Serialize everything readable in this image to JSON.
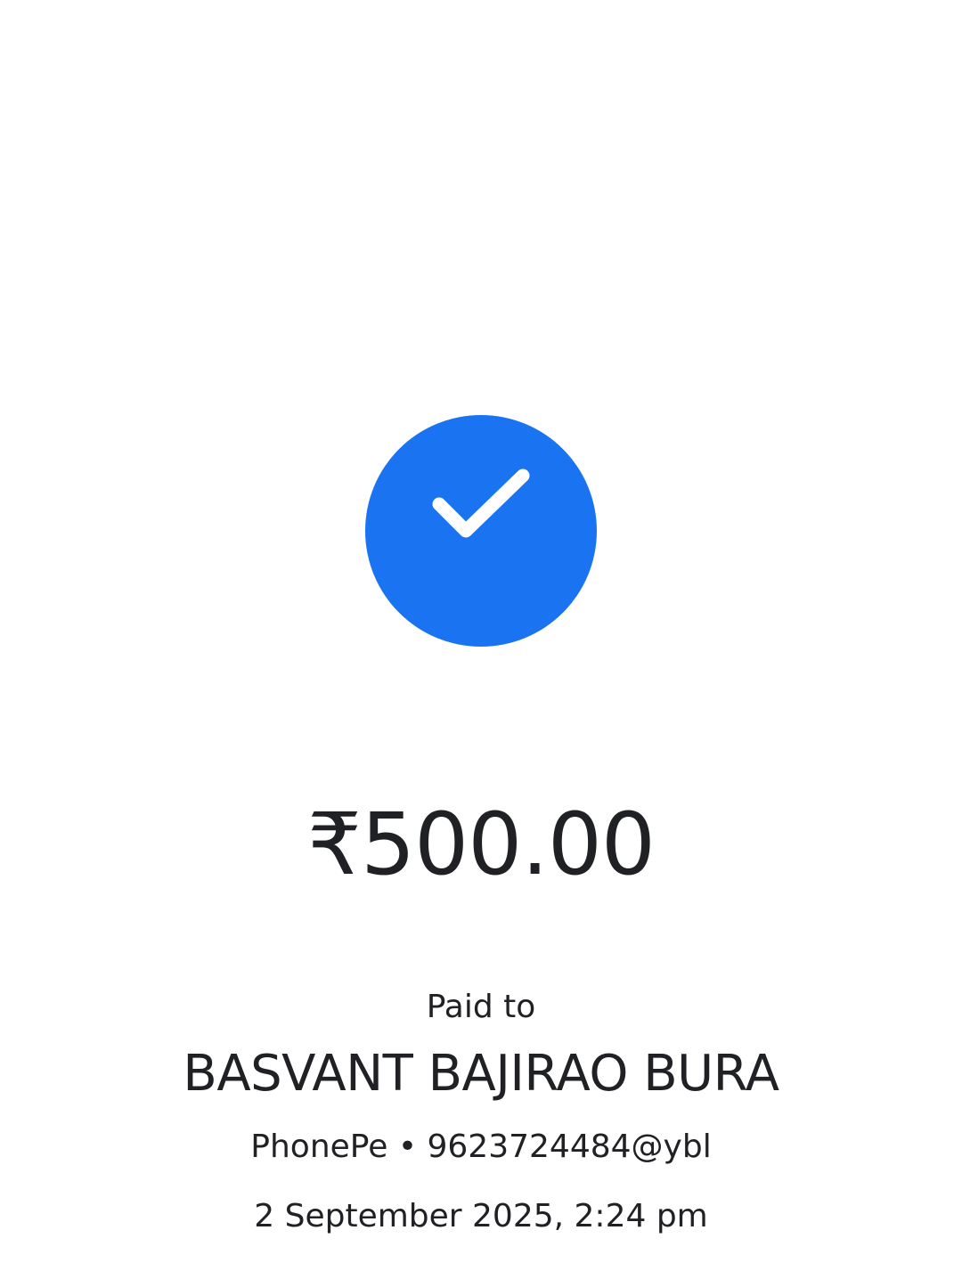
{
  "status": {
    "icon": "check-icon",
    "accent_color": "#1a73f0"
  },
  "payment": {
    "amount": "₹500.00",
    "paid_to_label": "Paid to",
    "recipient_name": "BASVANT BAJIRAO BURA",
    "recipient_upi": "PhonePe • 9623724484@ybl",
    "timestamp": "2 September 2025, 2:24 pm"
  }
}
